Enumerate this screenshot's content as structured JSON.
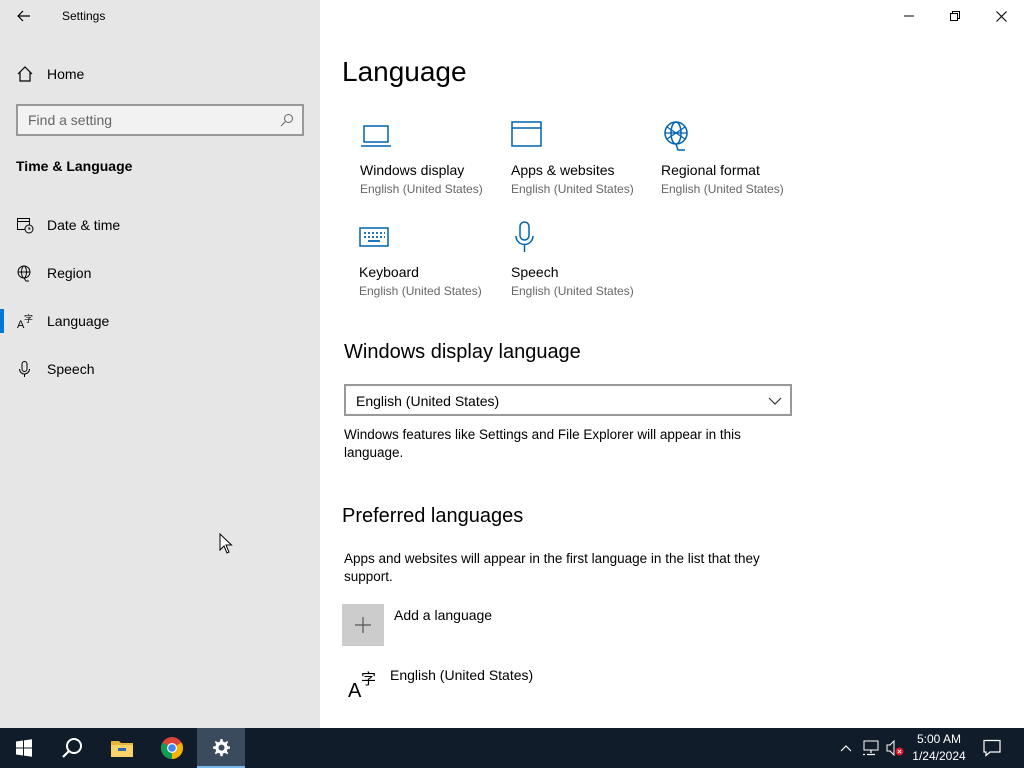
{
  "window": {
    "title": "Settings",
    "controls": [
      "minimize",
      "restore",
      "close"
    ]
  },
  "sidebar": {
    "home_label": "Home",
    "search_placeholder": "Find a setting",
    "section_title": "Time & Language",
    "items": [
      {
        "label": "Date & time",
        "icon": "calendar-clock-icon"
      },
      {
        "label": "Region",
        "icon": "globe-icon"
      },
      {
        "label": "Language",
        "icon": "language-icon",
        "selected": true
      },
      {
        "label": "Speech",
        "icon": "microphone-icon"
      }
    ]
  },
  "main": {
    "title": "Language",
    "tiles": [
      {
        "name": "Windows display",
        "sub": "English (United States)",
        "icon": "laptop-icon"
      },
      {
        "name": "Apps & websites",
        "sub": "English (United States)",
        "icon": "browser-window-icon"
      },
      {
        "name": "Regional format",
        "sub": "English (United States)",
        "icon": "globe-icon"
      },
      {
        "name": "Keyboard",
        "sub": "English (United States)",
        "icon": "keyboard-icon"
      },
      {
        "name": "Speech",
        "sub": "English (United States)",
        "icon": "microphone-icon"
      }
    ],
    "display_language": {
      "title": "Windows display language",
      "selected": "English (United States)",
      "description": "Windows features like Settings and File Explorer will appear in this language."
    },
    "preferred": {
      "title": "Preferred languages",
      "description": "Apps and websites will appear in the first language in the list that they support.",
      "add_label": "Add a language",
      "languages": [
        "English (United States)"
      ]
    }
  },
  "taskbar": {
    "apps": [
      "start-icon",
      "search-icon",
      "file-explorer-icon",
      "chrome-icon",
      "settings-icon"
    ],
    "time": "5:00 AM",
    "date": "1/24/2024"
  },
  "colors": {
    "accent": "#0078d7",
    "sidebar_bg": "#e6e6e6",
    "taskbar_bg": "#101c2a"
  }
}
